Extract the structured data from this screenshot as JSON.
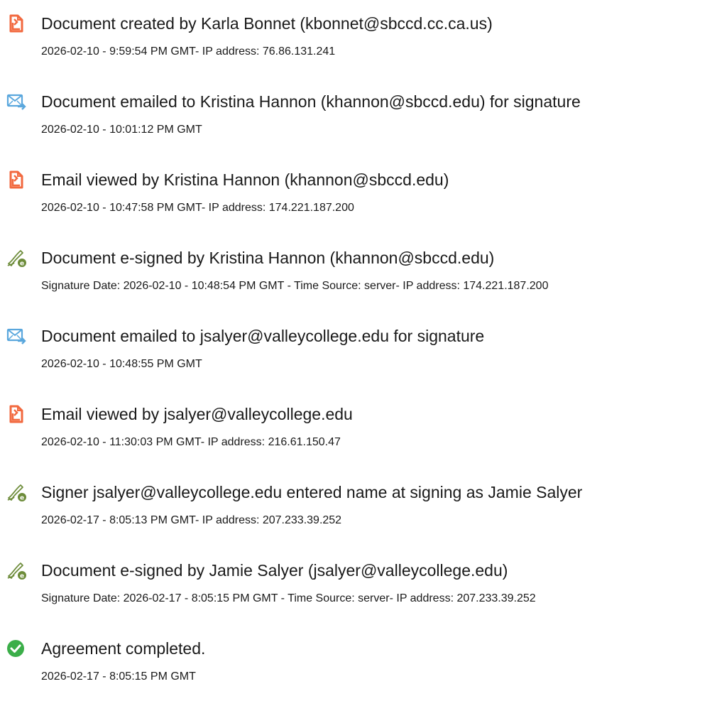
{
  "audit_events": [
    {
      "icon": "document-created-icon",
      "title": "Document created by Karla Bonnet (kbonnet@sbccd.cc.ca.us)",
      "detail": "2026-02-10 - 9:59:54 PM GMT- IP address: 76.86.131.241"
    },
    {
      "icon": "email-sent-icon",
      "title": "Document emailed to Kristina Hannon (khannon@sbccd.edu) for signature",
      "detail": "2026-02-10 - 10:01:12 PM GMT"
    },
    {
      "icon": "document-viewed-icon",
      "title": "Email viewed by Kristina Hannon (khannon@sbccd.edu)",
      "detail": "2026-02-10 - 10:47:58 PM GMT- IP address: 174.221.187.200"
    },
    {
      "icon": "e-sign-pen-icon",
      "title": "Document e-signed by Kristina Hannon (khannon@sbccd.edu)",
      "detail": "Signature Date: 2026-02-10 - 10:48:54 PM GMT - Time Source: server- IP address: 174.221.187.200"
    },
    {
      "icon": "email-sent-icon",
      "title": "Document emailed to jsalyer@valleycollege.edu for signature",
      "detail": "2026-02-10 - 10:48:55 PM GMT"
    },
    {
      "icon": "document-viewed-icon",
      "title": "Email viewed by jsalyer@valleycollege.edu",
      "detail": "2026-02-10 - 11:30:03 PM GMT- IP address: 216.61.150.47"
    },
    {
      "icon": "e-sign-pen-icon",
      "title": "Signer jsalyer@valleycollege.edu entered name at signing as Jamie Salyer",
      "detail": "2026-02-17 - 8:05:13 PM GMT- IP address: 207.233.39.252"
    },
    {
      "icon": "e-sign-pen-icon",
      "title": "Document e-signed by Jamie Salyer (jsalyer@valleycollege.edu)",
      "detail": "Signature Date: 2026-02-17 - 8:05:15 PM GMT - Time Source: server- IP address: 207.233.39.252"
    },
    {
      "icon": "check-circle-icon",
      "title": "Agreement completed.",
      "detail": "2026-02-17 - 8:05:15 PM GMT"
    }
  ],
  "colors": {
    "document_icon": "#f2693f",
    "email_icon": "#5aa7dd",
    "pen_icon": "#6d8c3a",
    "check_icon": "#3bae49",
    "text": "#1a1a1a"
  }
}
